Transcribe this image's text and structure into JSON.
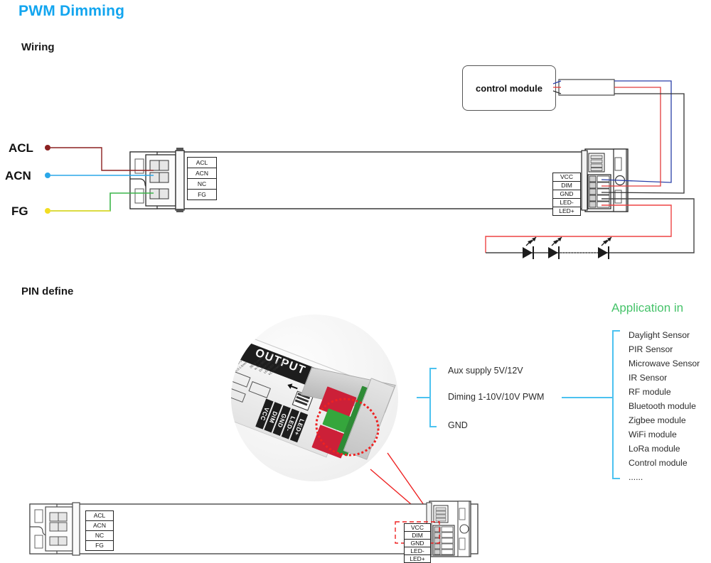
{
  "page": {
    "title": "PWM Dimming",
    "title_color": "#12a5ef"
  },
  "sections": {
    "wiring": {
      "heading": "Wiring"
    },
    "pin_define": {
      "heading": "PIN define"
    },
    "application": {
      "heading": "Application in",
      "heading_color": "#46c36a",
      "items": [
        "Daylight Sensor",
        "PIR Sensor",
        "Microwave Sensor",
        "IR Sensor",
        "RF module",
        "Bluetooth module",
        "Zigbee module",
        "WiFi module",
        "LoRa module",
        "Control module",
        "......"
      ]
    }
  },
  "wiring_diagram": {
    "input_labels": [
      {
        "name": "ACL",
        "wire_color": "#8b2020",
        "dot_color": "#8b2020"
      },
      {
        "name": "ACN",
        "wire_color": "#2aa7e8",
        "dot_color": "#2aa7e8"
      },
      {
        "name": "FG",
        "wire_color": "#3cb54a",
        "dot_color": "#f2dd22"
      }
    ],
    "control_module": {
      "label": "control module"
    },
    "control_cable_colors": [
      "#2a3fa8",
      "#e23b3b",
      "#333333"
    ],
    "input_terminal_pins": [
      "ACL",
      "ACN",
      "NC",
      "FG"
    ],
    "output_terminal_pins": [
      "VCC",
      "DIM",
      "GND",
      "LED-",
      "LED+"
    ],
    "led_string": {
      "count": 3,
      "positive_wire_color": "#ee4444",
      "negative_wire_color": "#444444"
    }
  },
  "pin_define_diagram": {
    "photo": {
      "output_label": "OUTPUT",
      "pin_bars": [
        "VCC",
        "DIM",
        "GND",
        "LED-",
        "LED+"
      ],
      "micro_lines": [
        "SELV connected",
        "to the SELV before",
        "Do not connect",
        "LED/LED- and",
        "VCC/DIM/GND wire"
      ],
      "small_labels": [
        "VCC INPUT",
        "0.5-1.5mm²",
        "0.5-1.5mm²"
      ],
      "highlight_color": "#ee2222"
    },
    "callouts": [
      {
        "label": "Aux supply 5V/12V"
      },
      {
        "label": "Diming 1-10V/10V PWM"
      },
      {
        "label": "GND"
      }
    ],
    "bracket_color": "#4cc2f0",
    "bottom_driver": {
      "input_terminal_pins": [
        "ACL",
        "ACN",
        "NC",
        "FG"
      ],
      "output_terminal_pins": [
        "VCC",
        "DIM",
        "GND",
        "LED-",
        "LED+"
      ],
      "highlight_color": "#ee2222"
    }
  }
}
